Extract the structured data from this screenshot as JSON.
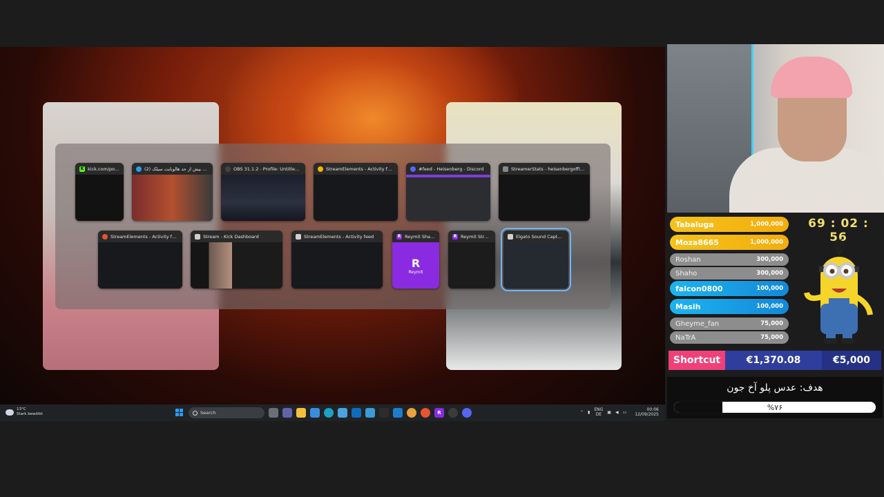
{
  "switcher": {
    "row1": [
      {
        "title": "kick.com/popo...",
        "icon_color": "#53fc18",
        "icon_char": "K"
      },
      {
        "title": "(2) سختی بیش از حد هالونایت سیلک...",
        "icon_color": "#2f9bf0",
        "icon_char": ""
      },
      {
        "title": "OBS 31.1.2 - Profile: Untitled - Sce...",
        "icon_color": "#444444",
        "icon_char": ""
      },
      {
        "title": "StreamElements - Activity feed - G...",
        "icon_color": "#f4b400",
        "icon_char": ""
      },
      {
        "title": "#feed - Heisenberg - Discord",
        "icon_color": "#5865f2",
        "icon_char": ""
      },
      {
        "title": "StreamerStats - heisenbergofficial Prof...",
        "icon_color": "#888888",
        "icon_char": ""
      }
    ],
    "row2": [
      {
        "title": "StreamElements - Activity feed —...",
        "icon_color": "#e8542f",
        "icon_char": ""
      },
      {
        "title": "Stream - Kick Dashboard",
        "icon_color": "#cfcfcf",
        "icon_char": ""
      },
      {
        "title": "StreamElements - Activity feed",
        "icon_color": "#cfcfcf",
        "icon_char": ""
      },
      {
        "title": "Reymit Sharing...",
        "icon_color": "#8a2be2",
        "icon_char": "R"
      },
      {
        "title": "Reymit Stream...",
        "icon_color": "#8a2be2",
        "icon_char": "R"
      },
      {
        "title": "Elgato Sound Capture",
        "icon_color": "#cfcfcf",
        "icon_char": ""
      }
    ],
    "reymit_card_letter": "R",
    "reymit_card_text": "Reymit"
  },
  "taskbar": {
    "weather_temp": "13°C",
    "weather_desc": "Stark bewölkt",
    "search_label": "Search",
    "lang_top": "ENG",
    "lang_bottom": "DE",
    "time": "00:06",
    "date": "12/09/2025"
  },
  "leaderboard": {
    "donors": [
      {
        "name": "Tabaluga",
        "amount": "1,000,000"
      },
      {
        "name": "Moza8665",
        "amount": "1,000,000"
      },
      {
        "name": "Roshan",
        "amount": "300,000"
      },
      {
        "name": "Shaho",
        "amount": "300,000"
      },
      {
        "name": "falcon0800",
        "amount": "100,000"
      },
      {
        "name": "Masih",
        "amount": "100,000"
      },
      {
        "name": "Gheyme_fan",
        "amount": "75,000"
      },
      {
        "name": "NaTrA",
        "amount": "75,000"
      }
    ],
    "colors": {
      "gold": "#f2c11f",
      "grey": "#8c8c8c",
      "blue": "#1aa3e8"
    }
  },
  "timer": "69 : 02 : 56",
  "goal_bar": {
    "label": "Shortcut",
    "current": "€1,370.08",
    "target": "€5,000"
  },
  "goal2": {
    "title": "هدف: عدس پلو آخ جون",
    "percent_label": "%۷۶",
    "progress": 0.76
  }
}
